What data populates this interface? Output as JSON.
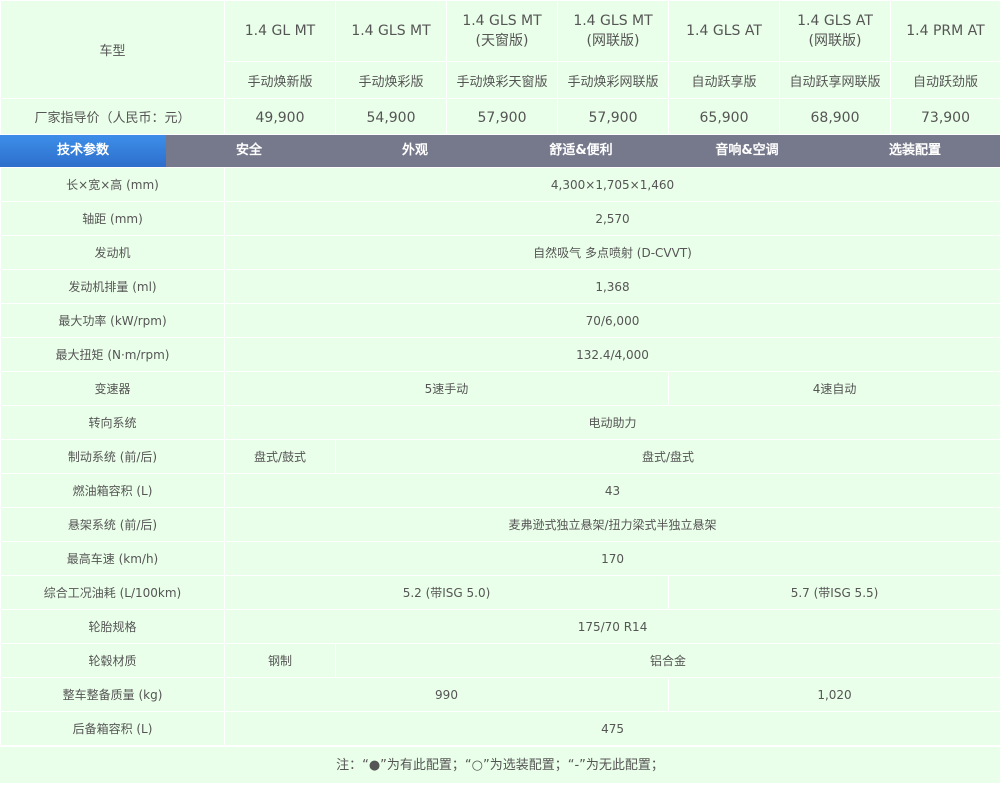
{
  "header": {
    "model_label": "车型",
    "price_label": "厂家指导价（人民币：元）",
    "models": [
      {
        "name": "1.4 GL MT",
        "variant": "",
        "sub": "手动焕新版",
        "price": "49,900"
      },
      {
        "name": "1.4 GLS MT",
        "variant": "",
        "sub": "手动焕彩版",
        "price": "54,900"
      },
      {
        "name": "1.4 GLS MT",
        "variant": "(天窗版)",
        "sub": "手动焕彩天窗版",
        "price": "57,900"
      },
      {
        "name": "1.4 GLS MT",
        "variant": "(网联版)",
        "sub": "手动焕彩网联版",
        "price": "57,900"
      },
      {
        "name": "1.4 GLS AT",
        "variant": "",
        "sub": "自动跃享版",
        "price": "65,900"
      },
      {
        "name": "1.4 GLS AT",
        "variant": "(网联版)",
        "sub": "自动跃享网联版",
        "price": "68,900"
      },
      {
        "name": "1.4 PRM AT",
        "variant": "",
        "sub": "自动跃劲版",
        "price": "73,900"
      }
    ]
  },
  "tabs": [
    {
      "label": "技术参数",
      "active": true
    },
    {
      "label": "安全",
      "active": false
    },
    {
      "label": "外观",
      "active": false
    },
    {
      "label": "舒适&便利",
      "active": false
    },
    {
      "label": "音响&空调",
      "active": false
    },
    {
      "label": "选装配置",
      "active": false
    }
  ],
  "params": [
    {
      "label": "长×宽×高 (mm)",
      "values": [
        "4,300×1,705×1,460"
      ]
    },
    {
      "label": "轴距 (mm)",
      "values": [
        "2,570"
      ]
    },
    {
      "label": "发动机",
      "values": [
        "自然吸气 多点喷射 (D-CVVT)"
      ]
    },
    {
      "label": "发动机排量 (ml)",
      "values": [
        "1,368"
      ]
    },
    {
      "label": "最大功率 (kW/rpm)",
      "values": [
        "70/6,000"
      ]
    },
    {
      "label": "最大扭矩 (N·m/rpm)",
      "values": [
        "132.4/4,000"
      ]
    },
    {
      "label": "变速器",
      "values": [
        "5速手动",
        "4速自动"
      ]
    },
    {
      "label": "转向系统",
      "values": [
        "电动助力"
      ]
    },
    {
      "label": "制动系统 (前/后)",
      "values": [
        "盘式/鼓式",
        "盘式/盘式"
      ]
    },
    {
      "label": "燃油箱容积 (L)",
      "values": [
        "43"
      ]
    },
    {
      "label": "悬架系统 (前/后)",
      "values": [
        "麦弗逊式独立悬架/扭力梁式半独立悬架"
      ]
    },
    {
      "label": "最高车速 (km/h)",
      "values": [
        "170"
      ]
    },
    {
      "label": "综合工况油耗 (L/100km)",
      "values": [
        "5.2 (带ISG 5.0)",
        "5.7 (带ISG 5.5)"
      ]
    },
    {
      "label": "轮胎规格",
      "values": [
        "175/70 R14"
      ]
    },
    {
      "label": "轮毂材质",
      "values": [
        "钢制",
        "铝合金"
      ]
    },
    {
      "label": "整车整备质量 (kg)",
      "values": [
        "990",
        "1,020"
      ]
    },
    {
      "label": "后备箱容积 (L)",
      "values": [
        "475"
      ]
    }
  ],
  "note": "注：“●”为有此配置；“○”为选装配置；“-”为无此配置；"
}
